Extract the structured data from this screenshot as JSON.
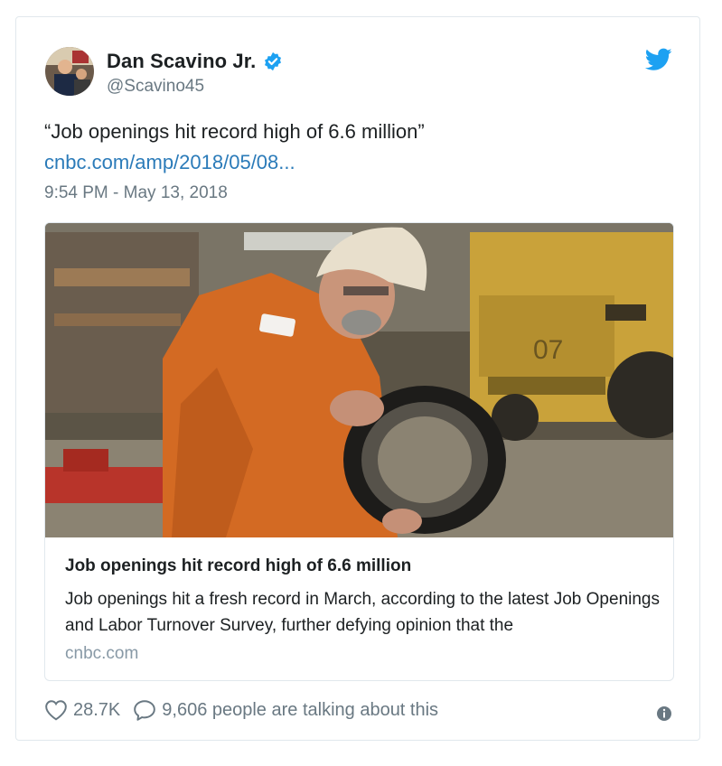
{
  "author": {
    "name": "Dan Scavino Jr.",
    "handle": "@Scavino45",
    "avatar_icon": "user-avatar",
    "verified": true
  },
  "tweet": {
    "text": "“Job openings hit record high of 6.6 million”",
    "link": "cnbc.com/amp/2018/05/08...",
    "timestamp": "9:54 PM - May 13, 2018"
  },
  "card": {
    "image_icon": "worker-with-tire-photo",
    "title": "Job openings hit record high of 6.6 million",
    "description": "Job openings hit a fresh record in March, according to the latest Job Openings and Labor Turnover Survey, further defying opinion that the",
    "domain": "cnbc.com"
  },
  "actions": {
    "likes": "28.7K",
    "conversation": "9,606 people are talking about this"
  },
  "colors": {
    "link": "#2b7bb9",
    "secondary_text": "#697882",
    "twitter_blue": "#1da1f2",
    "border": "#e1e8ed"
  }
}
